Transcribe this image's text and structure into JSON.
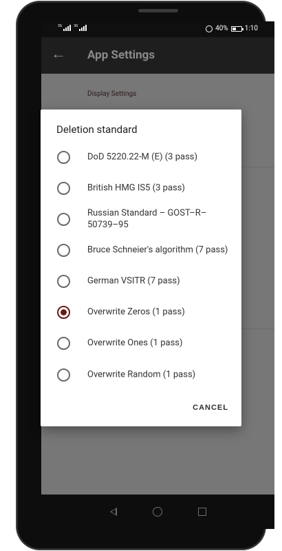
{
  "status_bar": {
    "sim1_label": "3G",
    "sim2_label": "3G",
    "battery_percent": "40%",
    "battery_level": 0.4,
    "time": "1:10",
    "alarm_icon": "alarm-icon"
  },
  "app_bar": {
    "title": "App Settings",
    "back_icon": "arrow-back-icon"
  },
  "settings": {
    "category": "Display Settings"
  },
  "dialog": {
    "title": "Deletion standard",
    "options": [
      {
        "label": "DoD 5220.22-M (E) (3 pass)",
        "checked": false
      },
      {
        "label": "British HMG IS5 (3 pass)",
        "checked": false
      },
      {
        "label": "Russian Standard – GOST–R–50739–95",
        "checked": false
      },
      {
        "label": "Bruce Schneier's algorithm (7 pass)",
        "checked": false
      },
      {
        "label": "German VSITR (7 pass)",
        "checked": false
      },
      {
        "label": "Overwrite Zeros (1 pass)",
        "checked": true
      },
      {
        "label": "Overwrite Ones (1 pass)",
        "checked": false
      },
      {
        "label": "Overwrite Random (1 pass)",
        "checked": false
      }
    ],
    "cancel_label": "CANCEL",
    "accent_color": "#6b1a1a"
  },
  "nav_bar": {
    "back_icon": "nav-back-icon",
    "home_icon": "nav-home-icon",
    "recents_icon": "nav-recents-icon"
  }
}
